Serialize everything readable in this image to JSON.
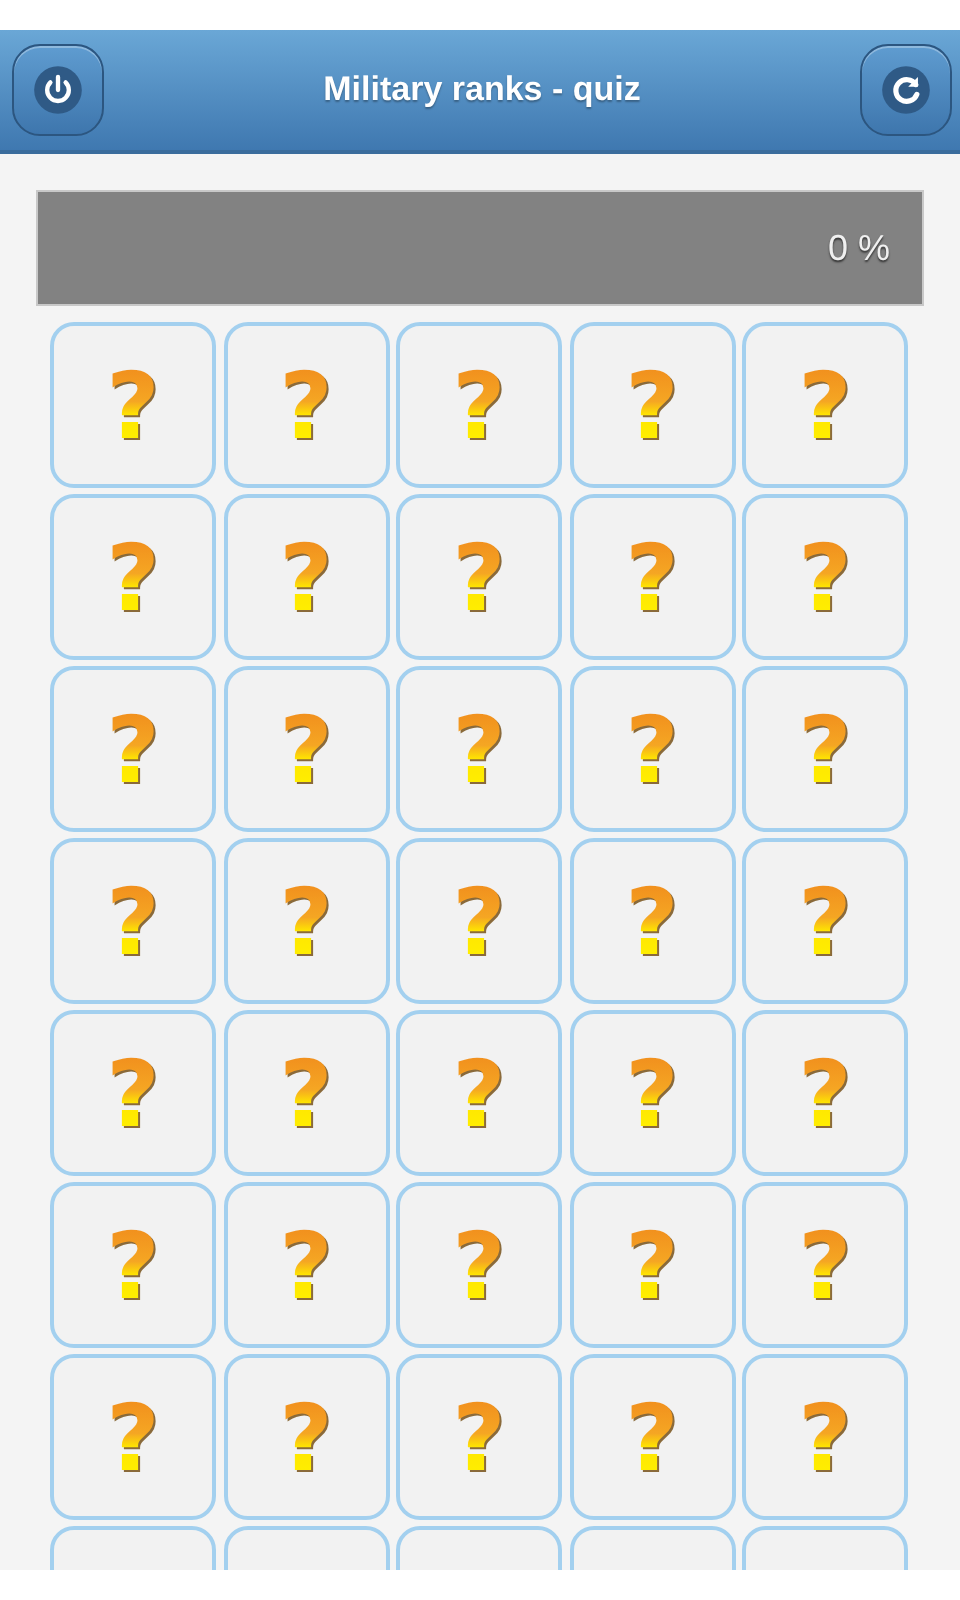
{
  "header": {
    "title": "Military ranks - quiz"
  },
  "progress": {
    "level": 0,
    "reading": "0 %"
  },
  "tiles": [
    {
      "kind": "card",
      "label": "?"
    },
    {
      "kind": "card",
      "label": "?"
    },
    {
      "kind": "card",
      "label": "?"
    },
    {
      "kind": "card",
      "label": "?"
    },
    {
      "kind": "card",
      "label": "?"
    },
    {
      "kind": "card",
      "label": "?"
    },
    {
      "kind": "card",
      "label": "?"
    },
    {
      "kind": "card",
      "label": "?"
    },
    {
      "kind": "card",
      "label": "?"
    },
    {
      "kind": "card",
      "label": "?"
    },
    {
      "kind": "card",
      "label": "?"
    },
    {
      "kind": "card",
      "label": "?"
    },
    {
      "kind": "card",
      "label": "?"
    },
    {
      "kind": "card",
      "label": "?"
    },
    {
      "kind": "card",
      "label": "?"
    },
    {
      "kind": "card",
      "label": "?"
    },
    {
      "kind": "card",
      "label": "?"
    },
    {
      "kind": "card",
      "label": "?"
    },
    {
      "kind": "card",
      "label": "?"
    },
    {
      "kind": "card",
      "label": "?"
    },
    {
      "kind": "card",
      "label": "?"
    },
    {
      "kind": "card",
      "label": "?"
    },
    {
      "kind": "card",
      "label": "?"
    },
    {
      "kind": "card",
      "label": "?"
    },
    {
      "kind": "card",
      "label": "?"
    },
    {
      "kind": "card",
      "label": "?"
    },
    {
      "kind": "card",
      "label": "?"
    },
    {
      "kind": "card",
      "label": "?"
    },
    {
      "kind": "card",
      "label": "?"
    },
    {
      "kind": "card",
      "label": "?"
    },
    {
      "kind": "card",
      "label": "?"
    },
    {
      "kind": "card",
      "label": "?"
    },
    {
      "kind": "card",
      "label": "?"
    },
    {
      "kind": "card",
      "label": "?"
    },
    {
      "kind": "card",
      "label": "?"
    },
    {
      "kind": "cut"
    },
    {
      "kind": "cut"
    },
    {
      "kind": "cut"
    },
    {
      "kind": "cut"
    },
    {
      "kind": "cut"
    }
  ]
}
